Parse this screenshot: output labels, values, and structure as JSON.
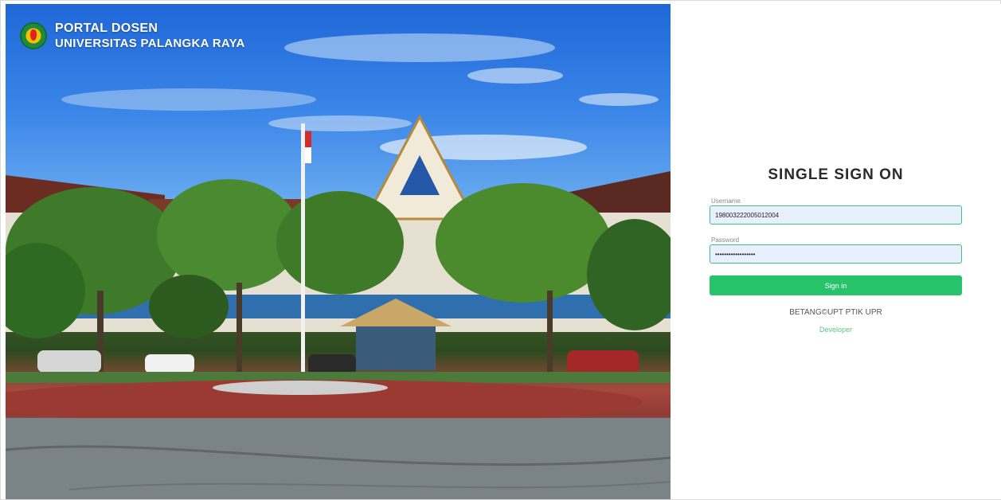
{
  "brand": {
    "line1": "PORTAL DOSEN",
    "line2": "UNIVERSITAS PALANGKA RAYA"
  },
  "login": {
    "title": "SINGLE SIGN ON",
    "username_label": "Username",
    "username_value": "198003222005012004",
    "password_label": "Password",
    "password_value": "••••••••••••••••••",
    "signin_label": "Sign in"
  },
  "footer": {
    "copyright": "BETANG©UPT PTIK UPR",
    "developer_link": "Developer"
  },
  "colors": {
    "accent": "#27c36a",
    "input_border": "#41c07b",
    "input_bg": "#e8f0fe",
    "link": "#5ec283"
  }
}
